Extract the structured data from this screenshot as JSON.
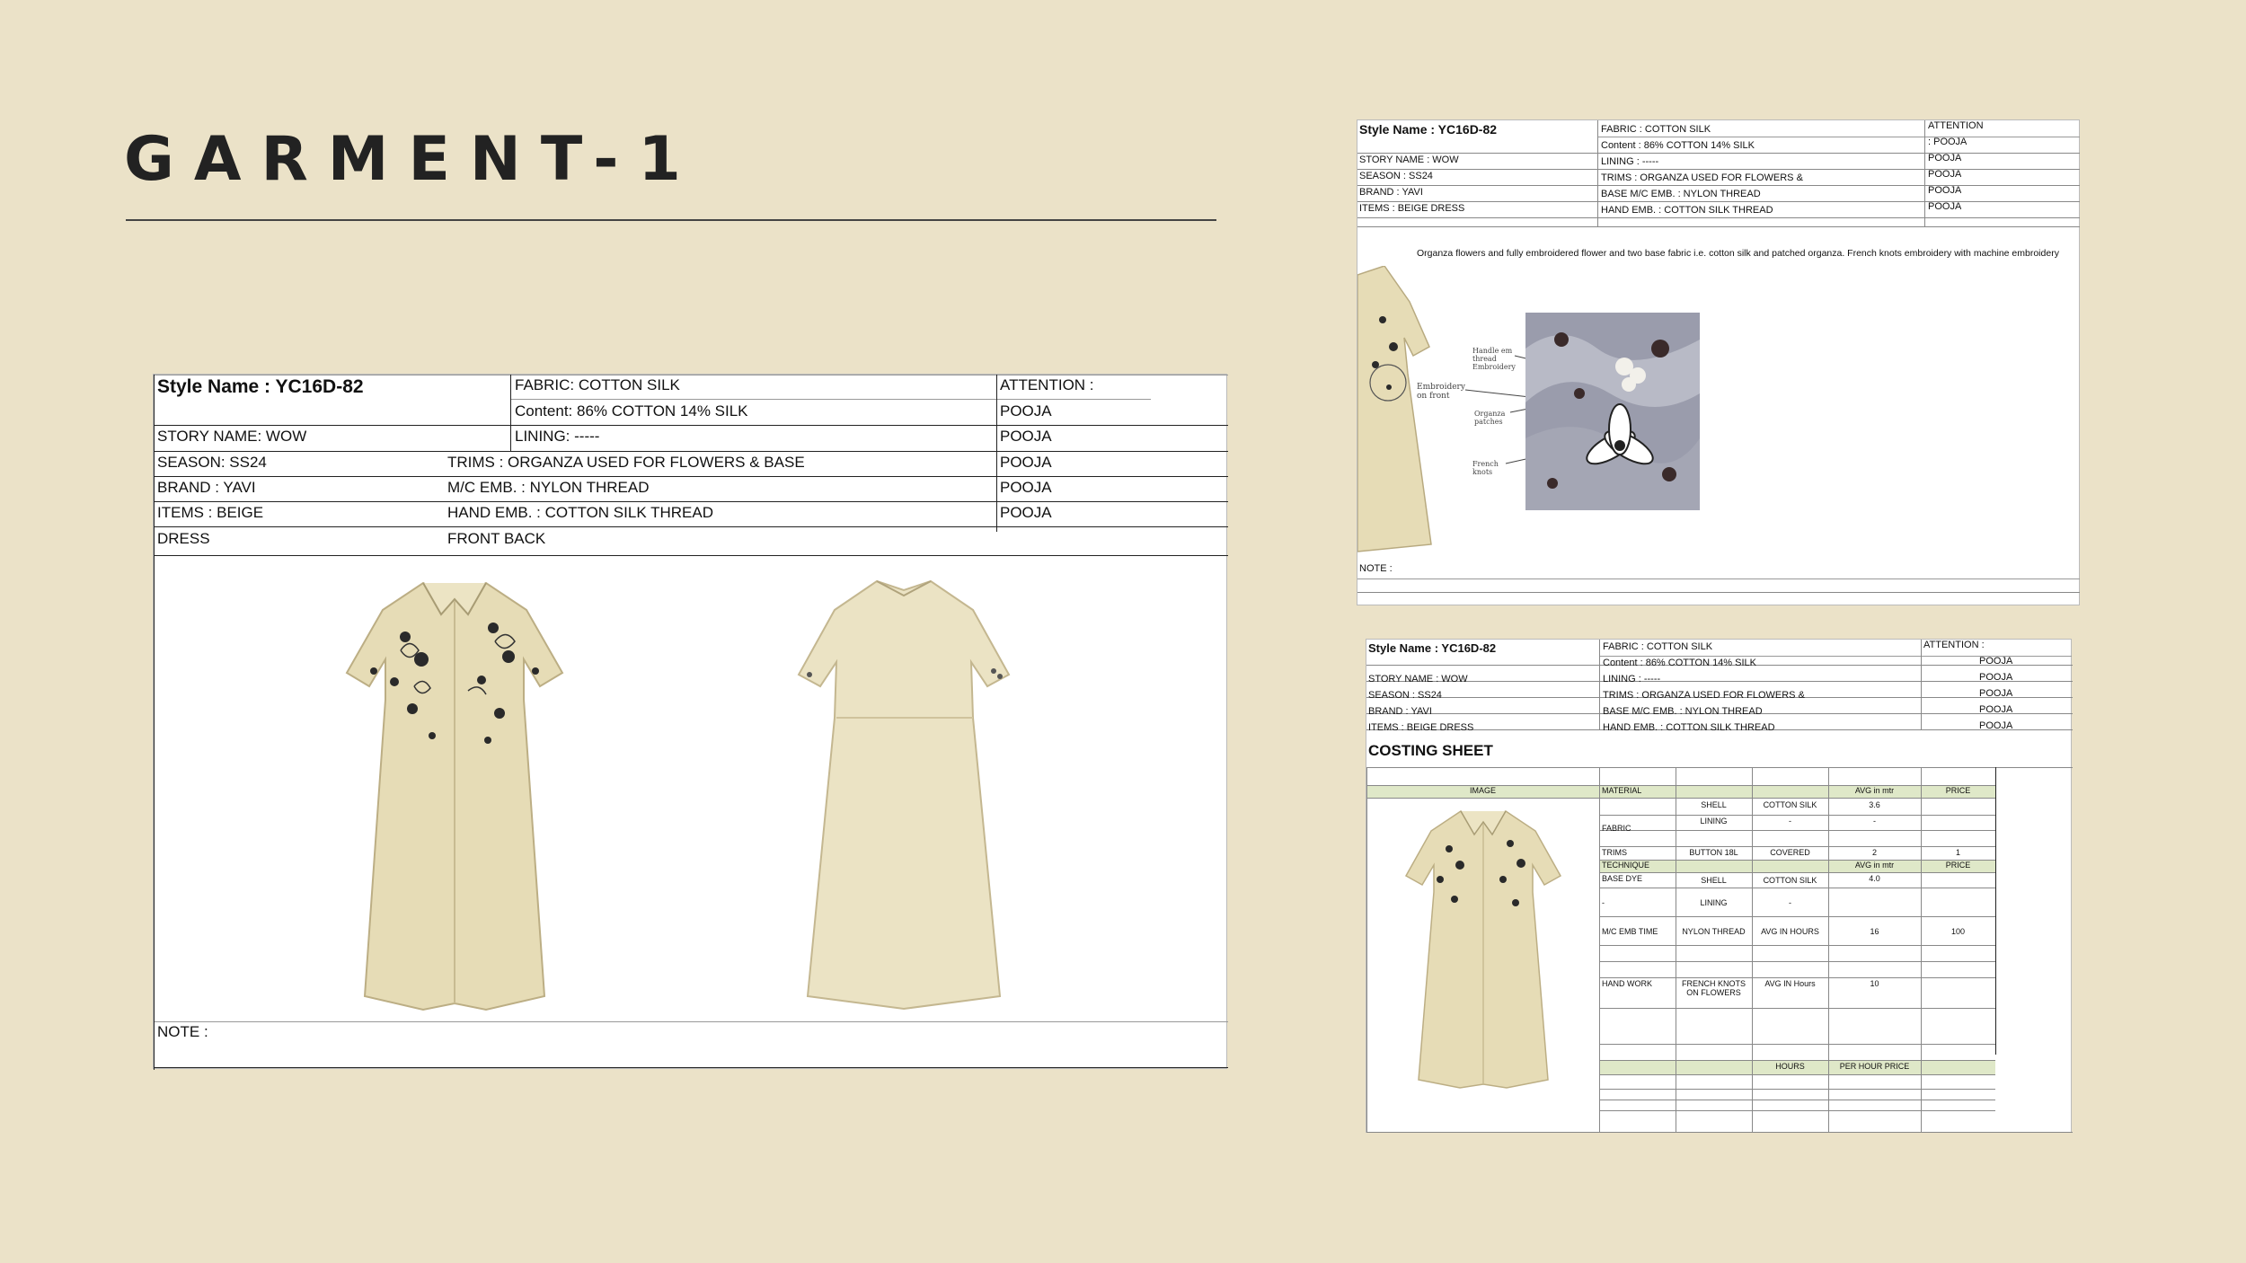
{
  "page": {
    "title": "GARMENT-1"
  },
  "sheet_main": {
    "style_name": "Style Name : YC16D-82",
    "fabric": "FABRIC: COTTON SILK",
    "content": "Content: 86% COTTON 14% SILK",
    "attention": "ATTENTION :",
    "story": "STORY NAME: WOW",
    "lining": "LINING: -----",
    "season": "SEASON: SS24",
    "trims": "TRIMS : ORGANZA USED FOR FLOWERS & BASE",
    "brand": "BRAND : YAVI",
    "mc_emb": "M/C EMB. : NYLON THREAD",
    "items": "ITEMS : BEIGE",
    "hand_emb": "HAND EMB. : COTTON SILK THREAD",
    "dress": "DRESS",
    "front_back": "FRONT BACK",
    "pooja": [
      "POOJA",
      "POOJA",
      "POOJA",
      "POOJA",
      "POOJA"
    ],
    "note": "NOTE :"
  },
  "sheet_detail": {
    "style_name": "Style Name : YC16D-82",
    "fabric": "FABRIC : COTTON SILK",
    "content": "Content : 86% COTTON 14% SILK",
    "lining": "LINING : -----",
    "trims": "TRIMS   :   ORGANZA   USED   FOR   FLOWERS   &",
    "base_mc": "BASE M/C EMB. : NYLON THREAD",
    "hand_emb": "HAND EMB. : COTTON SILK THREAD",
    "story": "STORY NAME : WOW",
    "season": "SEASON : SS24",
    "brand": "BRAND : YAVI",
    "items": "ITEMS : BEIGE DRESS",
    "attention": "ATTENTION",
    "attention_pooja": ": POOJA",
    "pooja": [
      "POOJA",
      "POOJA",
      "POOJA",
      "POOJA"
    ],
    "description": "Organza flowers and fully embroidered flower and two base fabric i.e. cotton silk and patched organza. French knots embroidery with machine embroidery",
    "annotations": [
      "Handle em thread Embroidery",
      "Embroidery on front",
      "Organza patches",
      "French knots"
    ],
    "note": "NOTE :"
  },
  "sheet_costing": {
    "style_name": "Style Name : YC16D-82",
    "fabric": "FABRIC : COTTON SILK",
    "content": "Content : 86% COTTON 14% SILK",
    "lining": "LINING : -----",
    "trims": "TRIMS   :   ORGANZA   USED   FOR   FLOWERS   &",
    "base_mc": "BASE M/C EMB. : NYLON THREAD",
    "hand_emb": "HAND EMB. : COTTON SILK THREAD",
    "story": "STORY NAME : WOW",
    "season": "SEASON : SS24",
    "brand": "BRAND : YAVI",
    "items": "ITEMS : BEIGE DRESS",
    "attention": "ATTENTION :",
    "pooja": [
      "POOJA",
      "POOJA",
      "POOJA",
      "POOJA",
      "POOJA"
    ],
    "costing_title": "COSTING SHEET",
    "hdr_image": "IMAGE",
    "hdr_material": "MATERIAL",
    "hdr_avg": "AVG in mtr",
    "hdr_price": "PRICE",
    "fabric_label": "FABRIC",
    "shell": "SHELL",
    "cotton_silk": "COTTON SILK",
    "shell_avg": "3.6",
    "lining_label": "LINING",
    "dash": "-",
    "trims_label": "TRIMS",
    "button": "BUTTON 18L",
    "covered": "COVERED",
    "button_qty": "2",
    "button_price": "1",
    "technique": "TECHNIQUE",
    "tech_avg": "AVG in mtr",
    "tech_price": "PRICE",
    "base_dye": "BASE DYE",
    "base_shell": "SHELL",
    "base_cotton": "COTTON SILK",
    "base_avg": "4.0",
    "base_dash": "-",
    "base_lining": "LINING",
    "base_dash2": "-",
    "mc_emb_time": "M/C EMB TIME",
    "nylon_thread": "NYLON THREAD",
    "avg_hours": "AVG IN HOURS",
    "mc_hours": "16",
    "mc_price": "100",
    "hand_work": "HAND WORK",
    "french_knots": "FRENCH KNOTS ON FLOWERS",
    "avg_hours2": "AVG IN Hours",
    "hand_hours": "10",
    "hours": "HOURS",
    "per_hour": "PER HOUR PRICE"
  }
}
